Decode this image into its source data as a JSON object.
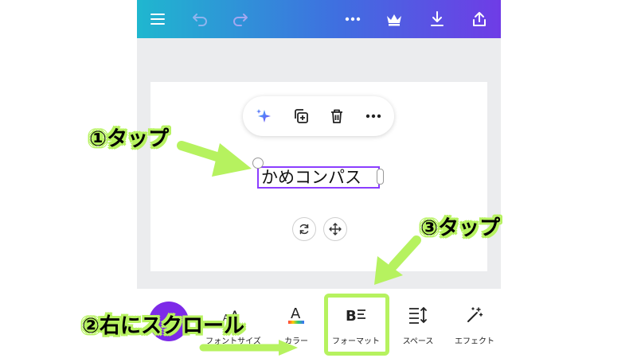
{
  "canvas": {
    "text_element": "かめコンパス"
  },
  "topbar": {
    "icons": [
      "menu-icon",
      "undo-icon",
      "redo-icon",
      "more-icon",
      "crown-icon",
      "download-icon",
      "share-icon"
    ]
  },
  "floating_toolbar": {
    "icons": [
      "magic-sparkle-icon",
      "duplicate-icon",
      "trash-icon",
      "more-icon"
    ]
  },
  "bottom_toolbar": {
    "items": [
      {
        "label": "フォントサイズ",
        "icon": "font-size-icon"
      },
      {
        "label": "カラー",
        "icon": "text-color-icon"
      },
      {
        "label": "フォーマット",
        "icon": "format-icon"
      },
      {
        "label": "スペース",
        "icon": "spacing-icon"
      },
      {
        "label": "エフェクト",
        "icon": "effects-icon"
      }
    ]
  },
  "annotations": {
    "step1": "①タップ",
    "step2": "②右にスクロール",
    "step3": "③タップ",
    "highlight_color": "#b6f25f"
  },
  "colors": {
    "brand_purple": "#8b3dff",
    "gradient_start": "#1fb7cf",
    "gradient_end": "#6f3ce6"
  }
}
